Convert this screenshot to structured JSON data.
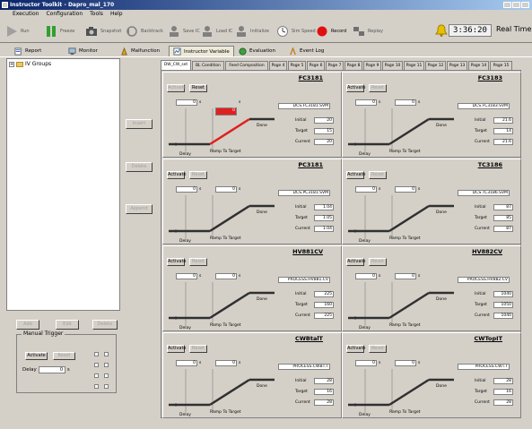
{
  "window": {
    "title": "Instructor Toolkit - Dapro_mal_170"
  },
  "menu": [
    "Execution",
    "Configuration",
    "Tools",
    "Help"
  ],
  "toolbar": {
    "buttons": [
      {
        "id": "run",
        "label": "Run"
      },
      {
        "id": "freeze",
        "label": "Freeze"
      },
      {
        "id": "snapshot",
        "label": "Snapshot"
      },
      {
        "id": "backtrack",
        "label": "Backtrack"
      },
      {
        "id": "save1",
        "label": "Save IC"
      },
      {
        "id": "save2",
        "label": "Load IC"
      },
      {
        "id": "save3",
        "label": "Initialize"
      },
      {
        "id": "speed",
        "label": "Sim Speed"
      },
      {
        "id": "record",
        "label": "Record"
      },
      {
        "id": "replay",
        "label": "Replay"
      }
    ],
    "clock": "3:36:20",
    "mode": "Real Time"
  },
  "main_tabs": [
    {
      "label": "Report"
    },
    {
      "label": "Monitor"
    },
    {
      "label": "Malfunction"
    },
    {
      "label": "Instructor Variable"
    },
    {
      "label": "Evaluation"
    },
    {
      "label": "Event Log"
    }
  ],
  "tree": {
    "root_label": "IV Groups"
  },
  "side_buttons": [
    "Insert",
    "Delete",
    "Append"
  ],
  "bottom_buttons": [
    "Add",
    "Edit",
    "Delete"
  ],
  "manual_trigger": {
    "legend": "Manual Trigger",
    "activate_label": "Activate",
    "reset_label": "Reset",
    "delay_label": "Delay",
    "delay_value": "0",
    "delay_unit": "s"
  },
  "page_tabs": [
    "DW_CW_set",
    "BL Condition",
    "Feed Composition",
    "Page 4",
    "Page 5",
    "Page 6",
    "Page 7",
    "Page 8",
    "Page 9",
    "Page 10",
    "Page 11",
    "Page 12",
    "Page 13",
    "Page 14",
    "Page 15"
  ],
  "panel_labels": {
    "activate": "Activate",
    "reset": "Reset",
    "initial": "Initial",
    "target": "Target",
    "current": "Current",
    "ramp": "Ramp To Target",
    "delay": "Delay",
    "done": "Done",
    "unit": "s"
  },
  "panels": [
    {
      "title": "FC3181",
      "tag": "DCS.FC3181.SVM",
      "delay": "0",
      "ramp": "0",
      "initial": "20",
      "target": "15",
      "current": "20",
      "active": true
    },
    {
      "title": "FC3183",
      "tag": "DCS.FC3183.SVM",
      "delay": "0",
      "ramp": "0",
      "initial": "21.6",
      "target": "14",
      "current": "21.6",
      "active": false
    },
    {
      "title": "PC3181",
      "tag": "DCS.PC3181.SVM",
      "delay": "0",
      "ramp": "0",
      "initial": "1.04",
      "target": "1.05",
      "current": "1.04",
      "active": false
    },
    {
      "title": "TC3186",
      "tag": "DCS.TC3186.SVM",
      "delay": "0",
      "ramp": "0",
      "initial": "87",
      "target": "85",
      "current": "87",
      "active": false
    },
    {
      "title": "HV881CV",
      "tag": "PROCESS.HV881.CV",
      "delay": "0",
      "ramp": "0",
      "initial": "225",
      "target": "160",
      "current": "225",
      "active": false
    },
    {
      "title": "HV882CV",
      "tag": "PROCESS.HV882.CV",
      "delay": "0",
      "ramp": "0",
      "initial": "1040",
      "target": "1050",
      "current": "1040",
      "active": false
    },
    {
      "title": "CWBtalT",
      "tag": "PROCESS.CWBT.T",
      "delay": "0",
      "ramp": "0",
      "initial": "28",
      "target": "16",
      "current": "28",
      "active": false
    },
    {
      "title": "CWTopIT",
      "tag": "PROCESS.CWT.T",
      "delay": "0",
      "ramp": "0",
      "initial": "28",
      "target": "16",
      "current": "28",
      "active": false
    }
  ],
  "colors": {
    "titlebar": "#0a246a",
    "ramp_active": "#e02020",
    "ramp_line": "#303030",
    "record": "#e01010"
  }
}
